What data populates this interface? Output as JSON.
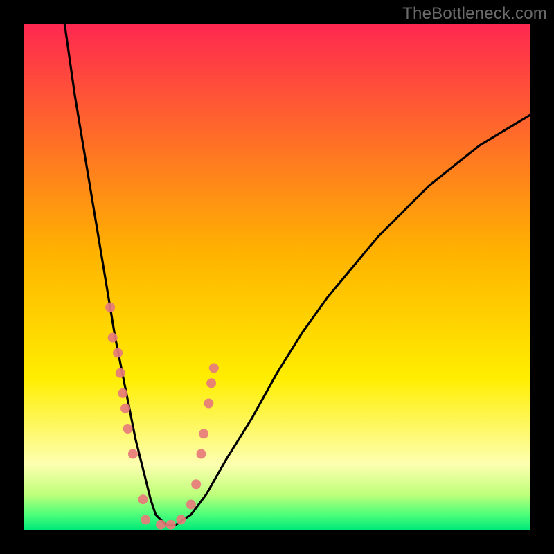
{
  "watermark": "TheBottleneck.com",
  "chart_data": {
    "type": "line",
    "title": "",
    "xlabel": "",
    "ylabel": "",
    "xlim": [
      0,
      100
    ],
    "ylim": [
      0,
      100
    ],
    "grid": false,
    "legend": false,
    "background_gradient": {
      "stops": [
        {
          "offset": 0.0,
          "color": "#ff2850"
        },
        {
          "offset": 0.45,
          "color": "#ffb200"
        },
        {
          "offset": 0.7,
          "color": "#ffee00"
        },
        {
          "offset": 0.87,
          "color": "#fdffb0"
        },
        {
          "offset": 0.93,
          "color": "#bfff7a"
        },
        {
          "offset": 0.97,
          "color": "#4dff7a"
        },
        {
          "offset": 1.0,
          "color": "#00e878"
        }
      ]
    },
    "series": [
      {
        "name": "bottleneck-curve",
        "color": "#000000",
        "x": [
          8,
          9,
          10,
          11,
          12,
          13,
          14,
          15,
          16,
          17,
          18,
          19,
          20,
          21,
          22,
          23,
          24,
          25,
          26,
          28,
          30,
          33,
          36,
          40,
          45,
          50,
          55,
          60,
          65,
          70,
          75,
          80,
          85,
          90,
          95,
          100
        ],
        "y": [
          100,
          93,
          86,
          80,
          74,
          68,
          62,
          56,
          50,
          44,
          38,
          33,
          28,
          23,
          18,
          14,
          10,
          6,
          3,
          1,
          1,
          3,
          7,
          14,
          22,
          31,
          39,
          46,
          52,
          58,
          63,
          68,
          72,
          76,
          79,
          82
        ]
      }
    ],
    "scatter": {
      "name": "markers",
      "color": "#e77b7b",
      "radius": 7,
      "x": [
        17.0,
        17.5,
        18.5,
        19.0,
        19.5,
        20.0,
        20.5,
        21.5,
        23.5,
        24.0,
        27.0,
        29.0,
        31.0,
        33.0,
        34.0,
        35.0,
        35.5,
        36.5,
        37.0,
        37.5
      ],
      "y": [
        44.0,
        38.0,
        35.0,
        31.0,
        27.0,
        24.0,
        20.0,
        15.0,
        6.0,
        2.0,
        1.0,
        1.0,
        2.0,
        5.0,
        9.0,
        15.0,
        19.0,
        25.0,
        29.0,
        32.0
      ]
    }
  }
}
